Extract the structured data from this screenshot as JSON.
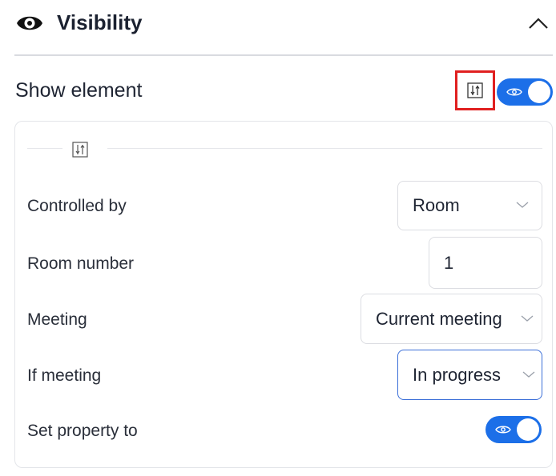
{
  "header": {
    "title": "Visibility"
  },
  "show_element": {
    "label": "Show element",
    "enabled": true
  },
  "rows": {
    "controlled_by": {
      "label": "Controlled by",
      "value": "Room"
    },
    "room_number": {
      "label": "Room number",
      "value": "1"
    },
    "meeting": {
      "label": "Meeting",
      "value": "Current meeting"
    },
    "if_meeting": {
      "label": "If meeting",
      "value": "In progress"
    },
    "set_property": {
      "label": "Set property to",
      "enabled": true
    }
  },
  "colors": {
    "accent": "#1c6fe8",
    "highlight": "#e02020",
    "focus": "#3b6fd8"
  }
}
